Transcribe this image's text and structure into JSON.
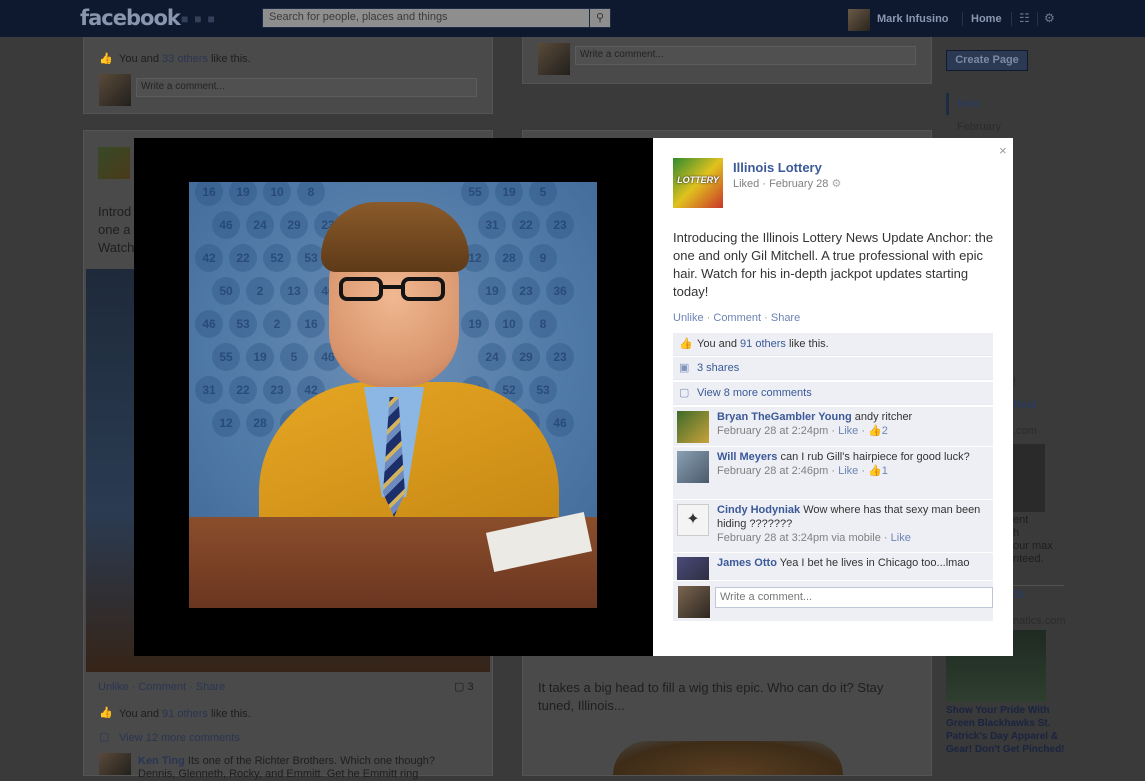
{
  "topbar": {
    "logo": "facebook",
    "search_placeholder": "Search for people, places and things",
    "user_name": "Mark Infusino",
    "home": "Home"
  },
  "background": {
    "card1": {
      "likes_you": "You and",
      "likes_count": "33 others",
      "likes_tail": "like this.",
      "comment_placeholder": "Write a comment..."
    },
    "card2": {
      "text_fragments": [
        "Introd",
        "one a",
        "Watch"
      ],
      "actions": [
        "Unlike",
        "Comment",
        "Share"
      ],
      "comment_count": "3",
      "likes_you": "You and",
      "likes_count": "91 others",
      "likes_tail": "like this.",
      "view_more": "View 12 more comments",
      "comment_author": "Ken Ting",
      "comment_text": "Its one of the Richter Brothers. Which one though?",
      "comment_cut": "Dennis, Glenneth, Rocky, and Emmitt. Get he Emmitt ring"
    },
    "center_card1": {
      "comment_placeholder": "Write a comment..."
    },
    "center_post_text": "It takes a big head to fill a wig this epic. Who can do it? Stay tuned, Illinois...",
    "right": {
      "create_page": "Create Page",
      "timeline": [
        "Now",
        "February"
      ],
      "ad_fragments": [
        "!",
        "Real",
        ".com",
        "ent",
        "h",
        "our max",
        "nteed.",
        "St",
        "natics.com"
      ],
      "ad_text": "Show Your Pride With Green Blackhawks St. Patrick's Day Apparel & Gear! Don't Get Pinched!"
    }
  },
  "photo": {
    "ball_numbers": [
      "16",
      "19",
      "10",
      "8",
      "55",
      "19",
      "5",
      "46",
      "24",
      "29",
      "23",
      "31",
      "22",
      "23",
      "42",
      "22",
      "52",
      "53",
      "12",
      "28",
      "9",
      "50",
      "2",
      "13",
      "46",
      "19",
      "23",
      "36",
      "46",
      "53",
      "2"
    ]
  },
  "panel": {
    "close": "×",
    "page_name": "Illinois Lottery",
    "logo_text": "LOTTERY",
    "meta": "Liked · February 28",
    "post_text": "Introducing the Illinois Lottery News Update Anchor: the one and only Gil Mitchell. A true professional with epic hair. Watch for his in-depth jackpot updates starting today!",
    "actions": {
      "unlike": "Unlike",
      "comment": "Comment",
      "share": "Share"
    },
    "likes": {
      "you": "You and",
      "count": "91 others",
      "tail": "like this."
    },
    "shares": "3 shares",
    "view_more": "View 8 more comments",
    "comments": [
      {
        "author": "Bryan TheGambler Young",
        "text": "andy ritcher",
        "time": "February 28 at 2:24pm",
        "like": "Like",
        "likes": "2"
      },
      {
        "author": "Will Meyers",
        "text": "can I rub Gill's hairpiece for good luck?",
        "time": "February 28 at 2:46pm",
        "like": "Like",
        "likes": "1"
      },
      {
        "author": "Cindy Hodyniak",
        "text": "Wow where has that sexy man been hiding ???????",
        "time": "February 28 at 3:24pm via mobile",
        "like": "Like",
        "likes": ""
      },
      {
        "author": "James Otto",
        "text": "Yea I bet he lives in Chicago too...lmao",
        "time": "",
        "like": "",
        "likes": ""
      }
    ],
    "write_placeholder": "Write a comment..."
  }
}
